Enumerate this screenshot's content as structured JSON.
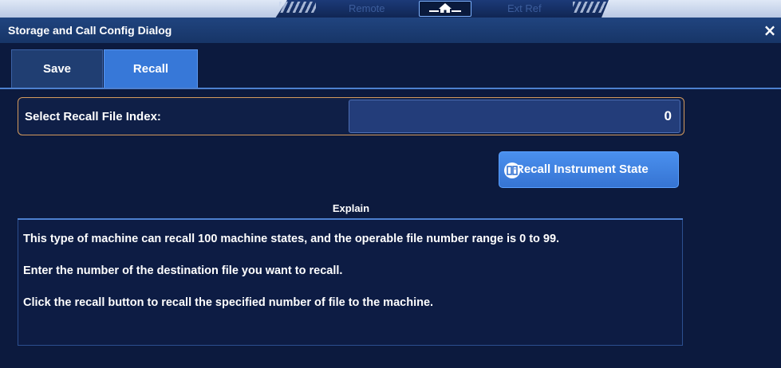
{
  "status_bar": {
    "remote_label": "Remote",
    "ext_ref_label": "Ext Ref",
    "home_icon": "home-icon"
  },
  "dialog": {
    "title": "Storage and Call Config Dialog",
    "close_label": "×"
  },
  "tabs": [
    {
      "label": "Save",
      "active": false
    },
    {
      "label": "Recall",
      "active": true
    }
  ],
  "recall": {
    "index_label": "Select Recall File Index:",
    "index_value": "0",
    "button_label": "Recall Instrument State",
    "button_icon": "recall-icon"
  },
  "explain": {
    "heading": "Explain",
    "paragraphs": [
      "This type of machine can recall 100 machine states, and the operable file number range is 0 to 99.",
      " Enter the number of the destination file you want to recall.",
      " Click the recall button to recall the specified number of file to the machine."
    ]
  },
  "colors": {
    "background": "#0c1a3e",
    "active_tab": "#3778d8",
    "accent_border": "#d49a5c"
  }
}
